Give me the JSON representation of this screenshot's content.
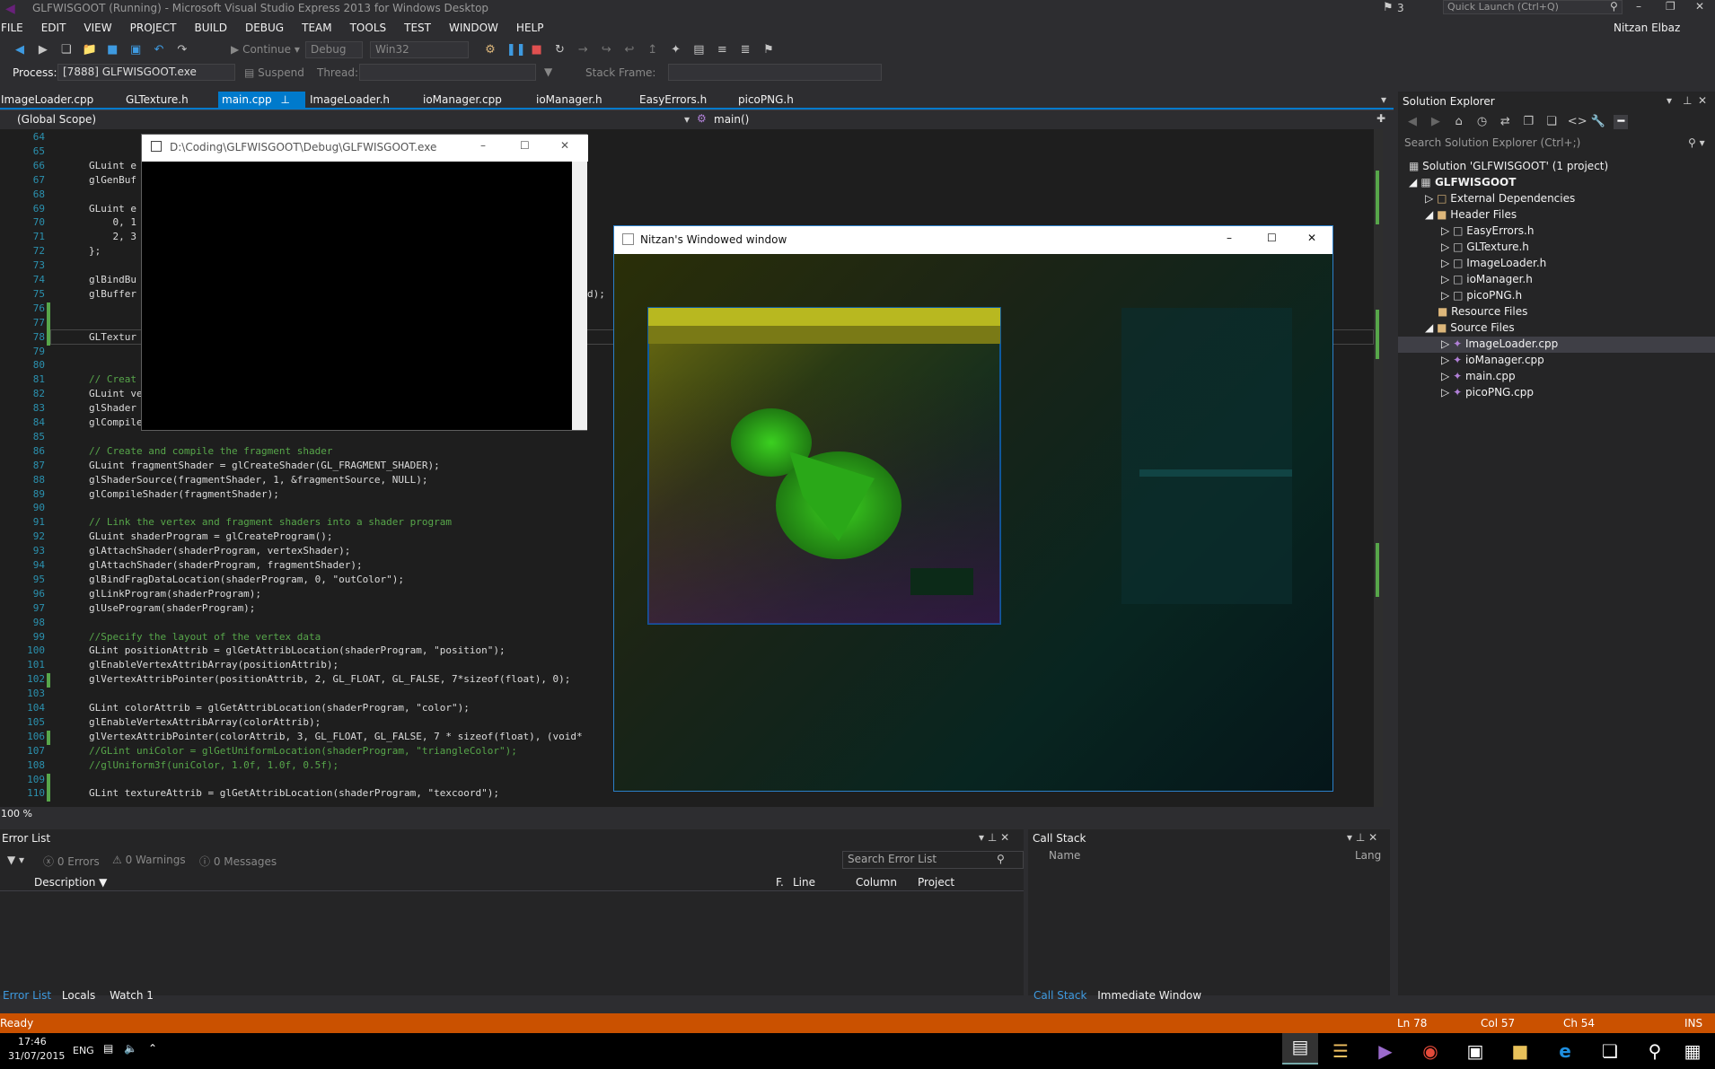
{
  "window": {
    "title": "GLFWISGOOT (Running) - Microsoft Visual Studio Express 2013 for Windows Desktop",
    "notifications": "3",
    "quick_launch_placeholder": "Quick Launch (Ctrl+Q)",
    "user": "Nitzan Elbaz"
  },
  "menu": [
    "FILE",
    "EDIT",
    "VIEW",
    "PROJECT",
    "BUILD",
    "DEBUG",
    "TEAM",
    "TOOLS",
    "TEST",
    "WINDOW",
    "HELP"
  ],
  "toolbar": {
    "continue": "Continue",
    "config": "Debug",
    "platform": "Win32",
    "process_label": "Process:",
    "process_value": "[7888] GLFWISGOOT.exe",
    "suspend": "Suspend",
    "thread_label": "Thread:",
    "stack_frame_label": "Stack Frame:"
  },
  "doc_tabs": [
    "ImageLoader.cpp",
    "GLTexture.h",
    "main.cpp",
    "ImageLoader.h",
    "ioManager.cpp",
    "ioManager.h",
    "EasyErrors.h",
    "picoPNG.h"
  ],
  "navbar": {
    "scope": "(Global Scope)",
    "member": "main()"
  },
  "editor": {
    "zoom": "100 %",
    "lines": [
      {
        "n": "64",
        "t": ""
      },
      {
        "n": "65",
        "t": ""
      },
      {
        "n": "66",
        "t": "GLuint e"
      },
      {
        "n": "67",
        "t": "glGenBuf"
      },
      {
        "n": "68",
        "t": ""
      },
      {
        "n": "69",
        "t": "GLuint e"
      },
      {
        "n": "70",
        "t": "    0, 1"
      },
      {
        "n": "71",
        "t": "    2, 3"
      },
      {
        "n": "72",
        "t": "};"
      },
      {
        "n": "73",
        "t": ""
      },
      {
        "n": "74",
        "t": "glBindBu"
      },
      {
        "n": "75",
        "t": "glBuffer"
      },
      {
        "n": "76",
        "t": ""
      },
      {
        "n": "77",
        "t": ""
      },
      {
        "n": "78",
        "t": "GLTextur"
      },
      {
        "n": "79",
        "t": ""
      },
      {
        "n": "80",
        "t": ""
      },
      {
        "n": "81",
        "t": "// Creat"
      },
      {
        "n": "82",
        "t": "GLuint ve"
      },
      {
        "n": "83",
        "t": "glShader"
      },
      {
        "n": "84",
        "t": "glCompile"
      },
      {
        "n": "85",
        "t": ""
      },
      {
        "n": "86",
        "t": "// Create and compile the fragment shader"
      },
      {
        "n": "87",
        "t": "GLuint fragmentShader = glCreateShader(GL_FRAGMENT_SHADER);"
      },
      {
        "n": "88",
        "t": "glShaderSource(fragmentShader, 1, &fragmentSource, NULL);"
      },
      {
        "n": "89",
        "t": "glCompileShader(fragmentShader);"
      },
      {
        "n": "90",
        "t": ""
      },
      {
        "n": "91",
        "t": "// Link the vertex and fragment shaders into a shader program"
      },
      {
        "n": "92",
        "t": "GLuint shaderProgram = glCreateProgram();"
      },
      {
        "n": "93",
        "t": "glAttachShader(shaderProgram, vertexShader);"
      },
      {
        "n": "94",
        "t": "glAttachShader(shaderProgram, fragmentShader);"
      },
      {
        "n": "95",
        "t": "glBindFragDataLocation(shaderProgram, 0, \"outColor\");"
      },
      {
        "n": "96",
        "t": "glLinkProgram(shaderProgram);"
      },
      {
        "n": "97",
        "t": "glUseProgram(shaderProgram);"
      },
      {
        "n": "98",
        "t": ""
      },
      {
        "n": "99",
        "t": "//Specify the layout of the vertex data"
      },
      {
        "n": "100",
        "t": "GLint positionAttrib = glGetAttribLocation(shaderProgram, \"position\");"
      },
      {
        "n": "101",
        "t": "glEnableVertexAttribArray(positionAttrib);"
      },
      {
        "n": "102",
        "t": "glVertexAttribPointer(positionAttrib, 2, GL_FLOAT, GL_FALSE, 7*sizeof(float), 0);"
      },
      {
        "n": "103",
        "t": ""
      },
      {
        "n": "104",
        "t": "GLint colorAttrib = glGetAttribLocation(shaderProgram, \"color\");"
      },
      {
        "n": "105",
        "t": "glEnableVertexAttribArray(colorAttrib);"
      },
      {
        "n": "106",
        "t": "glVertexAttribPointer(colorAttrib, 3, GL_FLOAT, GL_FALSE, 7 * sizeof(float), (void*"
      },
      {
        "n": "107",
        "t": "//GLint uniColor = glGetUniformLocation(shaderProgram, \"triangleColor\");"
      },
      {
        "n": "108",
        "t": "//glUniform3f(uniColor, 1.0f, 1.0f, 0.5f);"
      },
      {
        "n": "109",
        "t": ""
      },
      {
        "n": "110",
        "t": "GLint textureAttrib = glGetAttribLocation(shaderProgram, \"texcoord\");"
      }
    ],
    "line75_tail": "d);"
  },
  "console_window": {
    "title": "D:\\Coding\\GLFWISGOOT\\Debug\\GLFWISGOOT.exe"
  },
  "gl_window": {
    "title": "Nitzan's Windowed window"
  },
  "solution_explorer": {
    "title": "Solution Explorer",
    "search_placeholder": "Search Solution Explorer (Ctrl+;)",
    "solution": "Solution 'GLFWISGOOT' (1 project)",
    "project": "GLFWISGOOT",
    "external": "External Dependencies",
    "header_files": "Header Files",
    "headers": [
      "EasyErrors.h",
      "GLTexture.h",
      "ImageLoader.h",
      "ioManager.h",
      "picoPNG.h"
    ],
    "resource_files": "Resource Files",
    "source_files": "Source Files",
    "sources": [
      "ImageLoader.cpp",
      "ioManager.cpp",
      "main.cpp",
      "picoPNG.cpp"
    ]
  },
  "error_list": {
    "title": "Error List",
    "errors": "0 Errors",
    "warnings": "0 Warnings",
    "messages": "0 Messages",
    "search_placeholder": "Search Error List",
    "columns": [
      "Description",
      "F.",
      "Line",
      "Column",
      "Project"
    ],
    "bottom_tabs": [
      "Error List",
      "Locals",
      "Watch 1"
    ]
  },
  "call_stack": {
    "title": "Call Stack",
    "columns": [
      "Name",
      "Lang"
    ],
    "bottom_tabs": [
      "Call Stack",
      "Immediate Window"
    ]
  },
  "status": {
    "text": "Ready",
    "line": "Ln 78",
    "col": "Col 57",
    "ch": "Ch 54",
    "mode": "INS"
  },
  "taskbar": {
    "time": "17:46",
    "date": "31/07/2015",
    "lang": "ENG"
  },
  "colors": {
    "accent": "#007acc",
    "status": "#ca5100",
    "background": "#2d2d30",
    "editor": "#1e1e1e"
  }
}
